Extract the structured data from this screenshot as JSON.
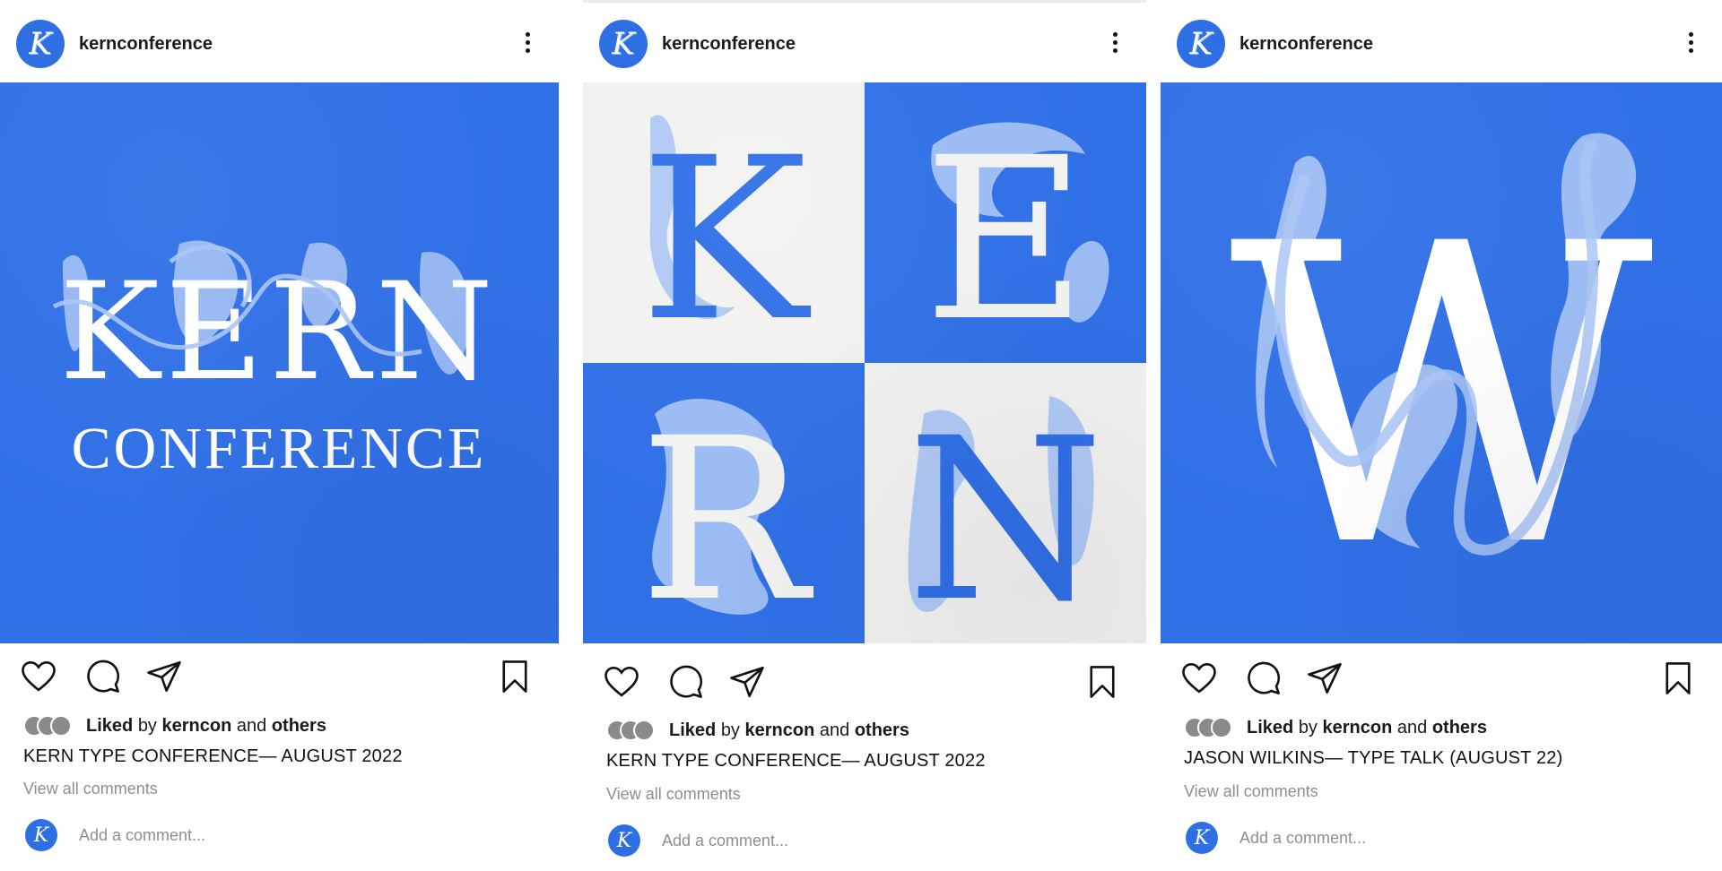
{
  "colors": {
    "brand_blue": "#3070e6",
    "light_blue": "#a9c4f5",
    "white": "#ffffff",
    "muted": "#8e8e8e"
  },
  "icons": [
    "heart-icon",
    "comment-icon",
    "share-icon",
    "bookmark-icon",
    "more-options-icon"
  ],
  "avatar_letter": "K",
  "posts": [
    {
      "username": "kernconference",
      "artwork": {
        "line1": "KERN",
        "line2": "CONFERENCE"
      },
      "liked_label": "Liked",
      "liked_by": "by",
      "liked_user": "kerncon",
      "liked_and": "and",
      "liked_others": "others",
      "caption": "KERN TYPE CONFERENCE— AUGUST 2022",
      "view_all": "View all comments",
      "add_comment_placeholder": "Add a comment..."
    },
    {
      "username": "kernconference",
      "artwork": {
        "k": "K",
        "e": "E",
        "r": "R",
        "n": "N"
      },
      "liked_label": "Liked",
      "liked_by": "by",
      "liked_user": "kerncon",
      "liked_and": "and",
      "liked_others": "others",
      "caption": "KERN TYPE CONFERENCE— AUGUST 2022",
      "view_all": "View all comments",
      "add_comment_placeholder": "Add a comment..."
    },
    {
      "username": "kernconference",
      "artwork": {
        "w": "W"
      },
      "liked_label": "Liked",
      "liked_by": "by",
      "liked_user": "kerncon",
      "liked_and": "and",
      "liked_others": "others",
      "caption": "JASON WILKINS— TYPE TALK (AUGUST 22)",
      "view_all": "View all comments",
      "add_comment_placeholder": "Add a comment..."
    }
  ]
}
